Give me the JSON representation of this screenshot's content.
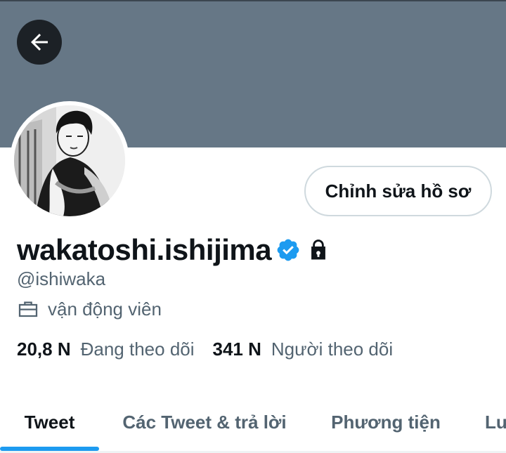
{
  "profile": {
    "display_name": "wakatoshi.ishijima",
    "handle": "@ishiwaka",
    "job": "vận động viên",
    "verified": true,
    "protected": true
  },
  "actions": {
    "edit_profile_label": "Chỉnh sửa hồ sơ"
  },
  "stats": {
    "following_count": "20,8 N",
    "following_label": "Đang theo dõi",
    "followers_count": "341 N",
    "followers_label": "Người theo dõi"
  },
  "tabs": [
    {
      "label": "Tweet",
      "active": true
    },
    {
      "label": "Các Tweet & trả lời",
      "active": false
    },
    {
      "label": "Phương tiện",
      "active": false
    },
    {
      "label": "Lư",
      "active": false
    }
  ],
  "colors": {
    "banner": "#667786",
    "accent": "#1d9bf0",
    "secondary_text": "#536471"
  },
  "icons": {
    "back": "arrow-left-icon",
    "verified": "verified-badge-icon",
    "protected": "lock-icon",
    "job": "briefcase-icon"
  }
}
